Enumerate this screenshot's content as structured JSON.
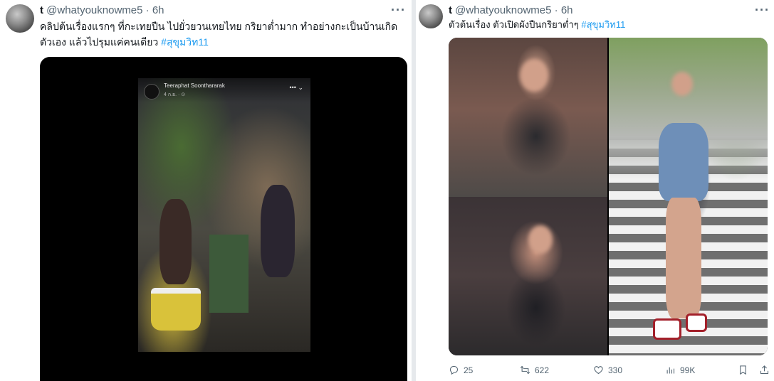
{
  "left_tweet": {
    "name": "t",
    "handle": "@whatyouknowme5",
    "dot": "·",
    "time": "6h",
    "more_icon": "more-horizontal-icon",
    "text_line1": "คลิปต้นเรื่องแรกๆ ที่กะเทยปืน ไปยั่วยวนเทยไทย กริยาต่ำมาก ทำอย่างกะเป็นบ้านเกิด",
    "text_line2": "ตัวเอง แล้วไปรุมแค่คนเดียว ",
    "hashtag": "#สุขุมวิท11",
    "video": {
      "account_name": "Teeraphat Soonthararak",
      "account_sub": "4 ก.ย. · ⊙",
      "controls": "•••  ⌄"
    }
  },
  "right_tweet": {
    "name": "t",
    "handle": "@whatyouknowme5",
    "dot": "·",
    "time": "6h",
    "more_icon": "more-horizontal-icon",
    "text": "ตัวต้นเรื่อง ตัวเปิดผังปืนกริยาต่ำๆ ",
    "hashtag": "#สุขุมวิท11",
    "actions": {
      "replies": "25",
      "reposts": "622",
      "likes": "330",
      "views": "99K"
    }
  }
}
